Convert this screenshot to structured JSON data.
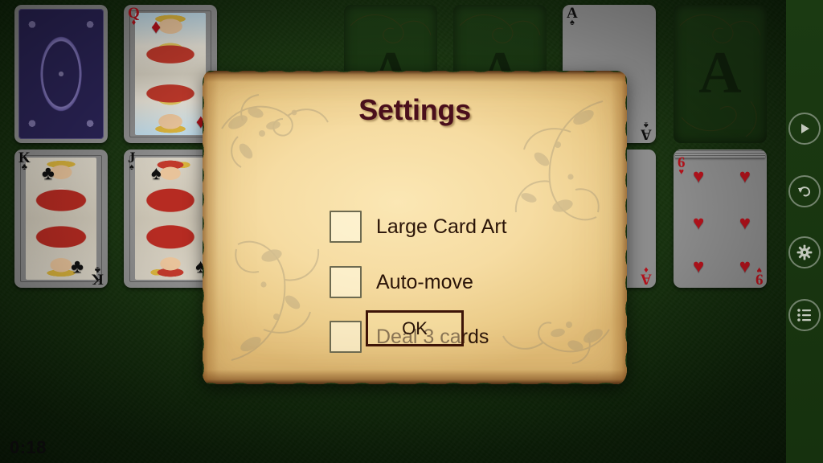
{
  "game": {
    "timer": "0:18",
    "felt_color": "#163009",
    "sidebar_color": "#1b3a12"
  },
  "sidebar": {
    "buttons": [
      {
        "name": "play-button",
        "icon": "play-icon",
        "label": "Play"
      },
      {
        "name": "undo-button",
        "icon": "undo-icon",
        "label": "Undo"
      },
      {
        "name": "settings-button",
        "icon": "gear-icon",
        "label": "Settings"
      },
      {
        "name": "menu-button",
        "icon": "list-icon",
        "label": "Menu"
      }
    ]
  },
  "table": {
    "cards": [
      {
        "id": "stock-back",
        "kind": "back",
        "rank": "",
        "suit": "",
        "color": ""
      },
      {
        "id": "waste-qd",
        "kind": "court",
        "rank": "Q",
        "suit": "♦",
        "color": "red",
        "art": "fig-qd"
      },
      {
        "id": "tableau-kc",
        "kind": "court",
        "rank": "K",
        "suit": "♣",
        "color": "black",
        "art": "fig-kc"
      },
      {
        "id": "tableau-js",
        "kind": "court",
        "rank": "J",
        "suit": "♠",
        "color": "black",
        "art": "fig-js"
      },
      {
        "id": "foundation-as",
        "kind": "pip",
        "rank": "A",
        "suit": "♠",
        "color": "black"
      },
      {
        "id": "tableau-ad",
        "kind": "pip",
        "rank": "A",
        "suit": "♦",
        "color": "red"
      },
      {
        "id": "tableau-6h",
        "kind": "pip",
        "rank": "6",
        "suit": "♥",
        "color": "red",
        "corner_br_rank": "9"
      }
    ],
    "empty_slots": [
      {
        "id": "foundation-slot-1",
        "letter": "A"
      },
      {
        "id": "foundation-slot-2",
        "letter": "A"
      },
      {
        "id": "foundation-slot-3",
        "letter": "A"
      }
    ]
  },
  "dialog": {
    "title": "Settings",
    "title_color": "#4a0f1c",
    "options": [
      {
        "label": "Large Card Art",
        "checked": false,
        "name": "large-card-art"
      },
      {
        "label": "Auto-move",
        "checked": false,
        "name": "auto-move"
      },
      {
        "label": "Deal 3 cards",
        "checked": false,
        "name": "deal-3-cards"
      }
    ],
    "ok_label": "OK"
  }
}
